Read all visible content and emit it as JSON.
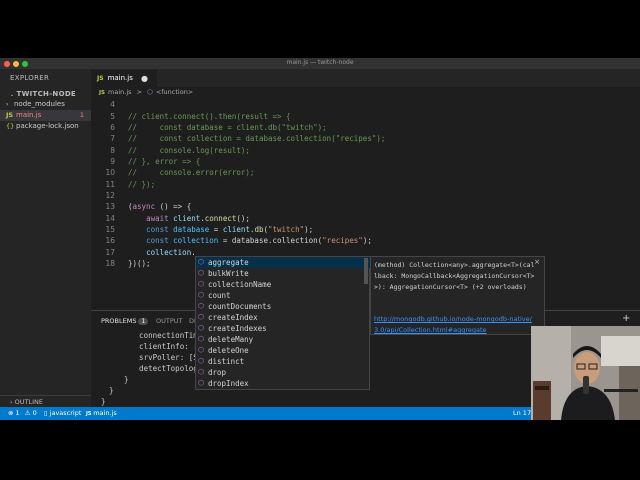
{
  "window": {
    "title": "main.js — twitch-node",
    "lights": [
      "#fe5f57",
      "#febc2e",
      "#28c840"
    ]
  },
  "sidebar": {
    "explorer_label": "EXPLORER",
    "section_label": "TWITCH-NODE",
    "items": [
      {
        "label": "node_modules",
        "icon": "chevron-right-icon"
      },
      {
        "label": "main.js",
        "icon": "js-file-icon",
        "badge": "1",
        "active": true
      },
      {
        "label": "package-lock.json",
        "icon": "json-file-icon"
      }
    ],
    "outline_label": "OUTLINE"
  },
  "tab": {
    "label": "main.js",
    "file_icon": "JS",
    "dirty_marker": "●"
  },
  "breadcrumb": {
    "file": "main.js",
    "separator": ">",
    "symbol": "<function>",
    "file_icon": "JS"
  },
  "editor": {
    "line_numbers": [
      "4",
      "5",
      "6",
      "7",
      "8",
      "9",
      "10",
      "11",
      "12",
      "13",
      "14",
      "15",
      "16",
      "17",
      "18"
    ],
    "lines": [
      "",
      "// client.connect().then(result => {",
      "//     const database = client.db(\"twitch\");",
      "//     const collection = database.collection(\"recipes\");",
      "//     console.log(result);",
      "// }, error => {",
      "//     console.error(error);",
      "// });",
      "",
      "(async () => {",
      "    await client.connect();",
      "    const database = client.db(\"twitch\");",
      "    const collection = database.collection(\"recipes\");",
      "    collection.",
      "})();"
    ]
  },
  "panel": {
    "tabs": [
      {
        "label": "PROBLEMS",
        "badge": "1"
      },
      {
        "label": "OUTPUT"
      },
      {
        "label": "DE"
      }
    ],
    "output_lines": [
      "    connectionTimers",
      "    clientInfo: [Ob",
      "    srvPoller: [Srv",
      "    detectTopologyDe",
      "  }",
      "}",
      "}"
    ],
    "plus": "+"
  },
  "status": {
    "errors_label": "⊗ 1",
    "warnings_label": "⚠ 0",
    "language": "javascript",
    "file": "main.js",
    "position": "Ln 17,"
  },
  "suggest": {
    "typed": "",
    "items": [
      "aggregate",
      "bulkWrite",
      "collectionName",
      "count",
      "countDocuments",
      "createIndex",
      "createIndexes",
      "deleteMany",
      "deleteOne",
      "distinct",
      "drop",
      "dropIndex"
    ],
    "selected_index": 0
  },
  "docs": {
    "signature": "(method) Collection<any>.aggregate<T>(callback: MongoCallback<AggregationCursor<T>>): AggregationCursor<T> (+2 overloads)",
    "link": "http://mongodb.github.io/node-mongodb-native/3.0/api/Collection.html#aggregate",
    "close": "×"
  }
}
